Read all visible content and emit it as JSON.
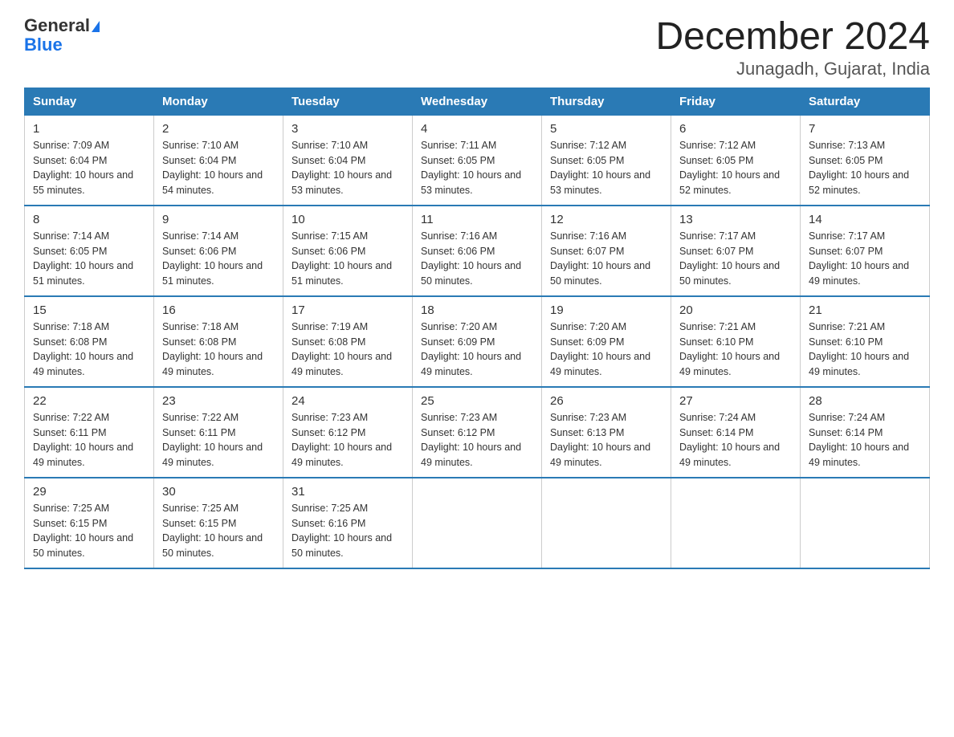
{
  "logo": {
    "general": "General",
    "blue": "Blue"
  },
  "title": "December 2024",
  "subtitle": "Junagadh, Gujarat, India",
  "days_header": [
    "Sunday",
    "Monday",
    "Tuesday",
    "Wednesday",
    "Thursday",
    "Friday",
    "Saturday"
  ],
  "weeks": [
    [
      {
        "num": "1",
        "sunrise": "7:09 AM",
        "sunset": "6:04 PM",
        "daylight": "10 hours and 55 minutes."
      },
      {
        "num": "2",
        "sunrise": "7:10 AM",
        "sunset": "6:04 PM",
        "daylight": "10 hours and 54 minutes."
      },
      {
        "num": "3",
        "sunrise": "7:10 AM",
        "sunset": "6:04 PM",
        "daylight": "10 hours and 53 minutes."
      },
      {
        "num": "4",
        "sunrise": "7:11 AM",
        "sunset": "6:05 PM",
        "daylight": "10 hours and 53 minutes."
      },
      {
        "num": "5",
        "sunrise": "7:12 AM",
        "sunset": "6:05 PM",
        "daylight": "10 hours and 53 minutes."
      },
      {
        "num": "6",
        "sunrise": "7:12 AM",
        "sunset": "6:05 PM",
        "daylight": "10 hours and 52 minutes."
      },
      {
        "num": "7",
        "sunrise": "7:13 AM",
        "sunset": "6:05 PM",
        "daylight": "10 hours and 52 minutes."
      }
    ],
    [
      {
        "num": "8",
        "sunrise": "7:14 AM",
        "sunset": "6:05 PM",
        "daylight": "10 hours and 51 minutes."
      },
      {
        "num": "9",
        "sunrise": "7:14 AM",
        "sunset": "6:06 PM",
        "daylight": "10 hours and 51 minutes."
      },
      {
        "num": "10",
        "sunrise": "7:15 AM",
        "sunset": "6:06 PM",
        "daylight": "10 hours and 51 minutes."
      },
      {
        "num": "11",
        "sunrise": "7:16 AM",
        "sunset": "6:06 PM",
        "daylight": "10 hours and 50 minutes."
      },
      {
        "num": "12",
        "sunrise": "7:16 AM",
        "sunset": "6:07 PM",
        "daylight": "10 hours and 50 minutes."
      },
      {
        "num": "13",
        "sunrise": "7:17 AM",
        "sunset": "6:07 PM",
        "daylight": "10 hours and 50 minutes."
      },
      {
        "num": "14",
        "sunrise": "7:17 AM",
        "sunset": "6:07 PM",
        "daylight": "10 hours and 49 minutes."
      }
    ],
    [
      {
        "num": "15",
        "sunrise": "7:18 AM",
        "sunset": "6:08 PM",
        "daylight": "10 hours and 49 minutes."
      },
      {
        "num": "16",
        "sunrise": "7:18 AM",
        "sunset": "6:08 PM",
        "daylight": "10 hours and 49 minutes."
      },
      {
        "num": "17",
        "sunrise": "7:19 AM",
        "sunset": "6:08 PM",
        "daylight": "10 hours and 49 minutes."
      },
      {
        "num": "18",
        "sunrise": "7:20 AM",
        "sunset": "6:09 PM",
        "daylight": "10 hours and 49 minutes."
      },
      {
        "num": "19",
        "sunrise": "7:20 AM",
        "sunset": "6:09 PM",
        "daylight": "10 hours and 49 minutes."
      },
      {
        "num": "20",
        "sunrise": "7:21 AM",
        "sunset": "6:10 PM",
        "daylight": "10 hours and 49 minutes."
      },
      {
        "num": "21",
        "sunrise": "7:21 AM",
        "sunset": "6:10 PM",
        "daylight": "10 hours and 49 minutes."
      }
    ],
    [
      {
        "num": "22",
        "sunrise": "7:22 AM",
        "sunset": "6:11 PM",
        "daylight": "10 hours and 49 minutes."
      },
      {
        "num": "23",
        "sunrise": "7:22 AM",
        "sunset": "6:11 PM",
        "daylight": "10 hours and 49 minutes."
      },
      {
        "num": "24",
        "sunrise": "7:23 AM",
        "sunset": "6:12 PM",
        "daylight": "10 hours and 49 minutes."
      },
      {
        "num": "25",
        "sunrise": "7:23 AM",
        "sunset": "6:12 PM",
        "daylight": "10 hours and 49 minutes."
      },
      {
        "num": "26",
        "sunrise": "7:23 AM",
        "sunset": "6:13 PM",
        "daylight": "10 hours and 49 minutes."
      },
      {
        "num": "27",
        "sunrise": "7:24 AM",
        "sunset": "6:14 PM",
        "daylight": "10 hours and 49 minutes."
      },
      {
        "num": "28",
        "sunrise": "7:24 AM",
        "sunset": "6:14 PM",
        "daylight": "10 hours and 49 minutes."
      }
    ],
    [
      {
        "num": "29",
        "sunrise": "7:25 AM",
        "sunset": "6:15 PM",
        "daylight": "10 hours and 50 minutes."
      },
      {
        "num": "30",
        "sunrise": "7:25 AM",
        "sunset": "6:15 PM",
        "daylight": "10 hours and 50 minutes."
      },
      {
        "num": "31",
        "sunrise": "7:25 AM",
        "sunset": "6:16 PM",
        "daylight": "10 hours and 50 minutes."
      },
      null,
      null,
      null,
      null
    ]
  ]
}
